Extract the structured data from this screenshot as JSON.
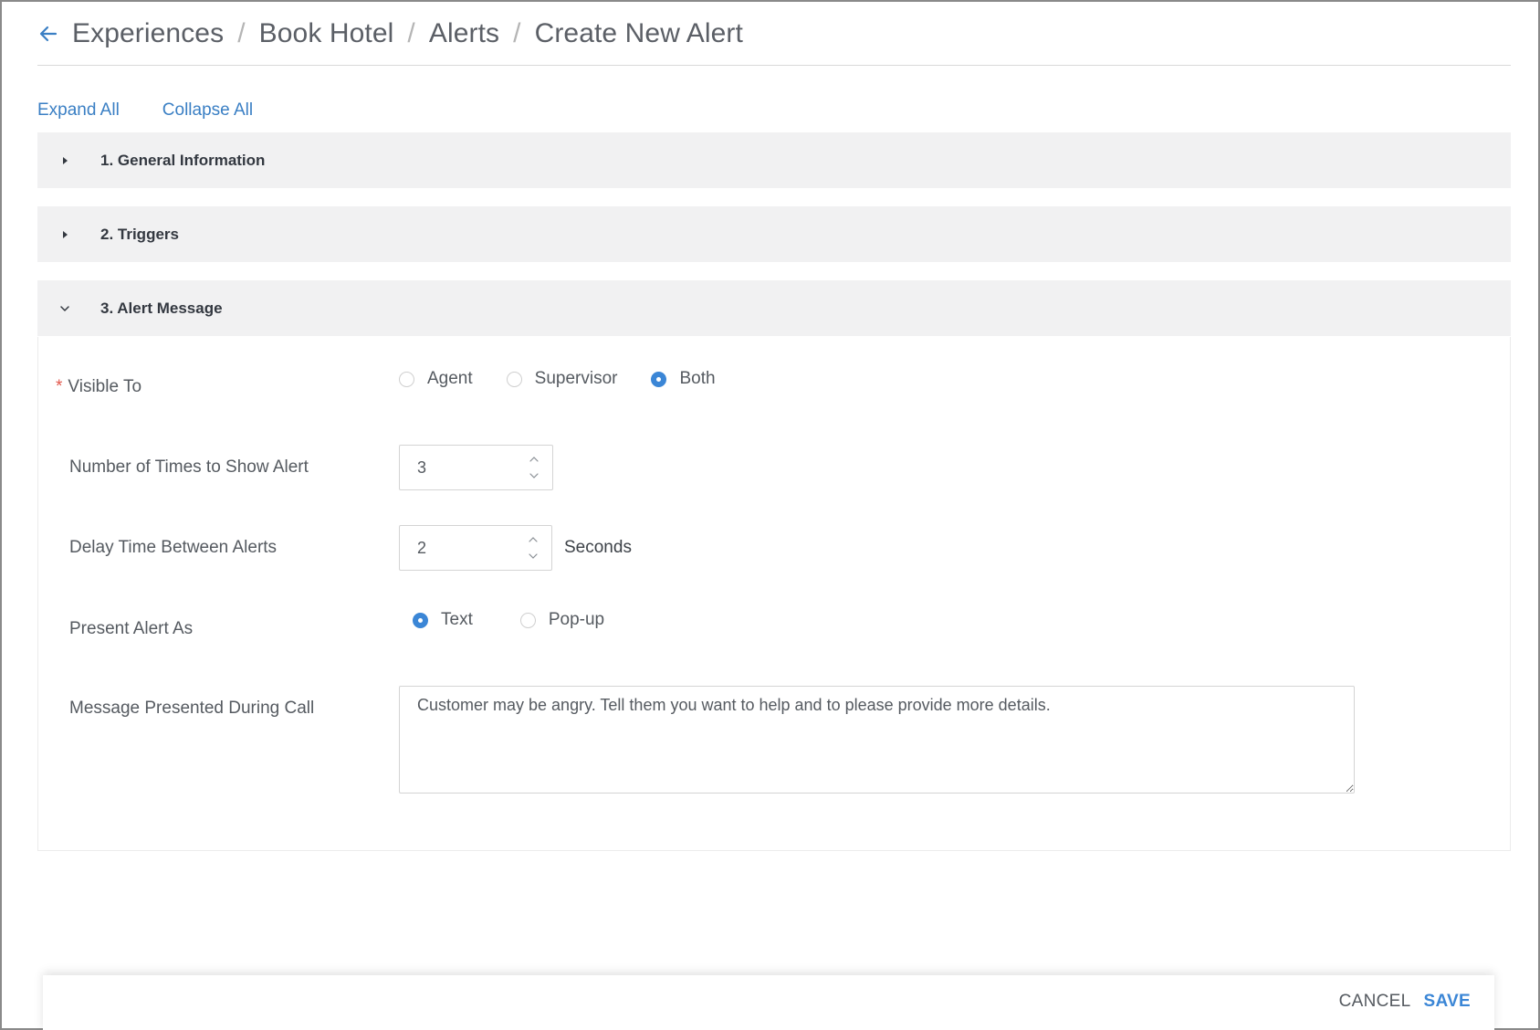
{
  "breadcrumb": {
    "items": [
      "Experiences",
      "Book Hotel",
      "Alerts",
      "Create New Alert"
    ],
    "separator": "/"
  },
  "toolbar": {
    "expand_all": "Expand All",
    "collapse_all": "Collapse All"
  },
  "sections": [
    {
      "label": "1. General Information",
      "expanded": false
    },
    {
      "label": "2. Triggers",
      "expanded": false
    },
    {
      "label": "3. Alert Message",
      "expanded": true
    }
  ],
  "form": {
    "visible_to": {
      "required_mark": "*",
      "label": "Visible To",
      "options": [
        "Agent",
        "Supervisor",
        "Both"
      ],
      "selected": "Both"
    },
    "times_to_show": {
      "label": "Number of Times to Show Alert",
      "value": "3"
    },
    "delay_between": {
      "label": "Delay Time Between Alerts",
      "value": "2",
      "unit": "Seconds"
    },
    "present_as": {
      "label": "Present Alert As",
      "options": [
        "Text",
        "Pop-up"
      ],
      "selected": "Text"
    },
    "message": {
      "label": "Message Presented During Call",
      "value": "Customer may be angry. Tell them you want to help and to please provide more details."
    }
  },
  "footer": {
    "cancel_label": "CANCEL",
    "save_label": "SAVE"
  },
  "colors": {
    "accent": "#3b86d6",
    "link": "#3a7fc4",
    "section_bg": "#f1f1f2",
    "required": "#e2574c"
  },
  "icons": {
    "back": "arrow-left-icon",
    "collapsed": "caret-right-icon",
    "expanded": "chevron-down-icon",
    "step_up": "chevron-up-icon",
    "step_down": "chevron-down-icon"
  }
}
